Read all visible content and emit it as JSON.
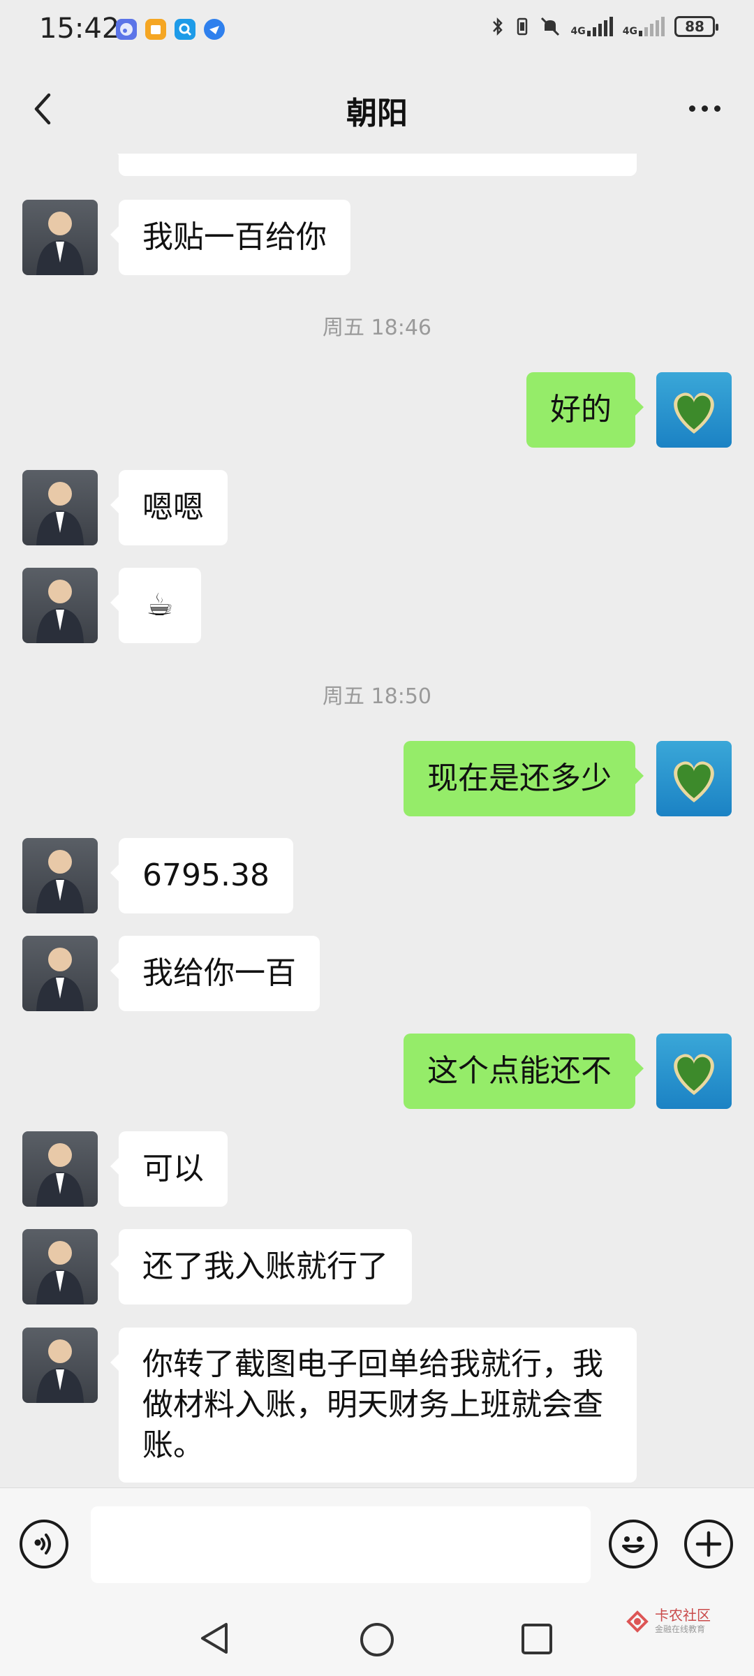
{
  "status_bar": {
    "time": "15:42",
    "battery": "88",
    "net1": "4G",
    "net2": "4G",
    "icons": [
      "music-app-icon",
      "package-app-icon",
      "search-app-icon",
      "browser-app-icon",
      "bluetooth-icon",
      "vibrate-icon",
      "mute-icon"
    ]
  },
  "header": {
    "title": "朝阳"
  },
  "timestamps": [
    "周五 18:46",
    "周五 18:50"
  ],
  "messages": [
    {
      "from": "other",
      "text": "我贴一百给你"
    },
    {
      "from": "me",
      "text": "好的"
    },
    {
      "from": "other",
      "text": "嗯嗯"
    },
    {
      "from": "other",
      "text": "☕"
    },
    {
      "from": "me",
      "text": "现在是还多少"
    },
    {
      "from": "other",
      "text": "6795.38"
    },
    {
      "from": "other",
      "text": "我给你一百"
    },
    {
      "from": "me",
      "text": "这个点能还不"
    },
    {
      "from": "other",
      "text": "可以"
    },
    {
      "from": "other",
      "text": "还了我入账就行了"
    },
    {
      "from": "other",
      "text": "你转了截图电子回单给我就行，我做材料入账，明天财务上班就会查账。"
    }
  ],
  "input_bar": {
    "value": "",
    "icons": [
      "voice-icon",
      "emoji-icon",
      "plus-icon"
    ]
  },
  "system_nav": {
    "icons": [
      "back-triangle-icon",
      "home-circle-icon",
      "recents-square-icon"
    ]
  },
  "watermark": {
    "text": "卡农社区",
    "sub": "金融在线教育"
  },
  "colors": {
    "background": "#ededed",
    "incoming_bubble": "#ffffff",
    "outgoing_bubble": "#95ec69"
  }
}
